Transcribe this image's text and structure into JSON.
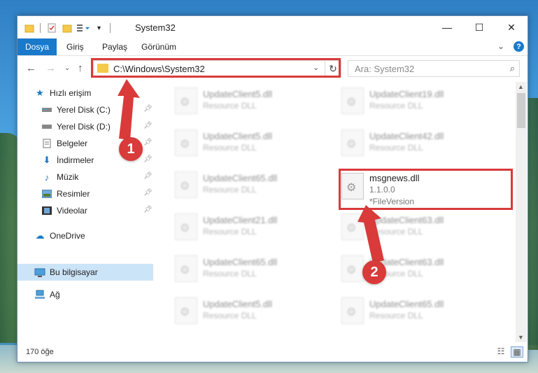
{
  "window": {
    "title": "System32"
  },
  "window_controls": {
    "minimize": "—",
    "maximize": "☐",
    "close": "✕"
  },
  "ribbon": {
    "tabs": [
      "Dosya",
      "Giriş",
      "Paylaş",
      "Görünüm"
    ],
    "help": "?"
  },
  "address_bar": {
    "path": "C:\\Windows\\System32"
  },
  "search": {
    "placeholder": "Ara: System32"
  },
  "sidebar": {
    "items": [
      {
        "label": "Hızlı erişim",
        "icon": "star-icon"
      },
      {
        "label": "Yerel Disk (C:)",
        "icon": "drive-icon",
        "pinned": true
      },
      {
        "label": "Yerel Disk (D:)",
        "icon": "drive-icon",
        "pinned": true
      },
      {
        "label": "Belgeler",
        "icon": "documents-icon",
        "pinned": true
      },
      {
        "label": "İndirmeler",
        "icon": "downloads-icon",
        "pinned": true
      },
      {
        "label": "Müzik",
        "icon": "music-icon",
        "pinned": true
      },
      {
        "label": "Resimler",
        "icon": "pictures-icon",
        "pinned": true
      },
      {
        "label": "Videolar",
        "icon": "videos-icon",
        "pinned": true
      },
      {
        "label": "OneDrive",
        "icon": "cloud-icon"
      },
      {
        "label": "Bu bilgisayar",
        "icon": "computer-icon",
        "selected": true
      },
      {
        "label": "Ağ",
        "icon": "network-icon"
      }
    ]
  },
  "files": {
    "left": [
      {
        "name": "UpdateClient5.dll",
        "type": "Resource DLL"
      },
      {
        "name": "UpdateClient5.dll",
        "type": "Resource DLL"
      },
      {
        "name": "UpdateClient65.dll",
        "type": "Resource DLL"
      },
      {
        "name": "UpdateClient21.dll",
        "type": "Resource DLL"
      },
      {
        "name": "UpdateClient65.dll",
        "type": "Resource DLL"
      },
      {
        "name": "UpdateClient5.dll",
        "type": "Resource DLL"
      }
    ],
    "right": [
      {
        "name": "UpdateClient19.dll",
        "type": "Resource DLL"
      },
      {
        "name": "UpdateClient42.dll",
        "type": "Resource DLL"
      },
      {
        "name": "msgnews.dll",
        "version": "1.1.0.0",
        "description": "*FileVersion",
        "highlighted": true
      },
      {
        "name": "UpdateClient63.dll",
        "type": "Resource DLL"
      },
      {
        "name": "UpdateClient63.dll",
        "type": "Resource DLL"
      },
      {
        "name": "UpdateClient65.dll",
        "type": "Resource DLL"
      }
    ]
  },
  "status": {
    "item_count": "170 öğe"
  },
  "callouts": [
    "1",
    "2"
  ],
  "colors": {
    "accent": "#1979ca",
    "highlight": "#d93a3a",
    "selection": "#cce4f7"
  }
}
